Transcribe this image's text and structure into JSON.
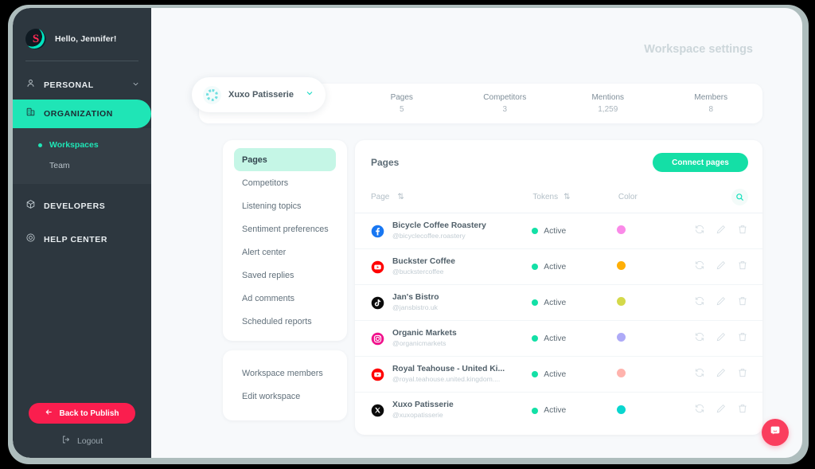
{
  "sidebar": {
    "greeting": "Hello, Jennifer!",
    "logo_letter": "S",
    "nav": [
      {
        "label": "PERSONAL",
        "icon": "person-icon",
        "active": false,
        "chevron": "chevron-down-icon"
      },
      {
        "label": "ORGANIZATION",
        "icon": "building-icon",
        "active": true
      }
    ],
    "subitems": [
      {
        "label": "Workspaces",
        "current": true
      },
      {
        "label": "Team",
        "current": false
      }
    ],
    "nav2": [
      {
        "label": "DEVELOPERS",
        "icon": "cube-icon"
      },
      {
        "label": "HELP CENTER",
        "icon": "lifebuoy-icon"
      }
    ],
    "publish_button": "Back to Publish",
    "logout": "Logout",
    "accent": "#1fe5b6",
    "publish_color": "#fa1e4e"
  },
  "header": {
    "title": "Workspace settings"
  },
  "workspace_select": {
    "name": "Xuxo Patisserie",
    "icon": "workspace-avatar-icon",
    "chevron": "chevron-down-icon"
  },
  "stats": [
    {
      "key": "Pages",
      "value": "5"
    },
    {
      "key": "Competitors",
      "value": "3"
    },
    {
      "key": "Mentions",
      "value": "1,259"
    },
    {
      "key": "Members",
      "value": "8"
    }
  ],
  "left_menu": [
    {
      "label": "Pages",
      "selected": true
    },
    {
      "label": "Competitors",
      "selected": false
    },
    {
      "label": "Listening topics",
      "selected": false
    },
    {
      "label": "Sentiment preferences",
      "selected": false
    },
    {
      "label": "Alert center",
      "selected": false
    },
    {
      "label": "Saved replies",
      "selected": false
    },
    {
      "label": "Ad comments",
      "selected": false
    },
    {
      "label": "Scheduled reports",
      "selected": false
    }
  ],
  "workspace_menu": [
    {
      "label": "Workspace members"
    },
    {
      "label": "Edit workspace"
    }
  ],
  "panel": {
    "title": "Pages",
    "connect_button": "Connect pages",
    "search_icon": "search-icon",
    "columns": [
      {
        "label": "Page",
        "sort": "⇅"
      },
      {
        "label": "Tokens",
        "sort": "⇅"
      },
      {
        "label": "Color",
        "sort": ""
      }
    ],
    "rows": [
      {
        "platform": "facebook",
        "name": "Bicycle Coffee Roastery",
        "handle": "@bicyclecoffee.roastery",
        "token": "Active",
        "color": "#fa8ae8"
      },
      {
        "platform": "youtube",
        "name": "Buckster Coffee",
        "handle": "@buckstercoffee",
        "token": "Active",
        "color": "#ffaf06"
      },
      {
        "platform": "tiktok",
        "name": "Jan's Bistro",
        "handle": "@jansbistro.uk",
        "token": "Active",
        "color": "#d4d94a"
      },
      {
        "platform": "instagram",
        "name": "Organic Markets",
        "handle": "@organicmarkets",
        "token": "Active",
        "color": "#aeaaf7"
      },
      {
        "platform": "youtube",
        "name": "Royal Teahouse - United Ki...",
        "handle": "@royal.teahouse.united.kingdom....",
        "token": "Active",
        "color": "#ffb3ad"
      },
      {
        "platform": "x",
        "name": "Xuxo Patisserie",
        "handle": "@xuxopatisserie",
        "token": "Active",
        "color": "#0ad6cf"
      }
    ],
    "row_actions": [
      "refresh-icon",
      "edit-icon",
      "delete-icon"
    ]
  },
  "chat_widget": {
    "icon": "chat-bubble-icon",
    "color": "#fa3e5e"
  }
}
